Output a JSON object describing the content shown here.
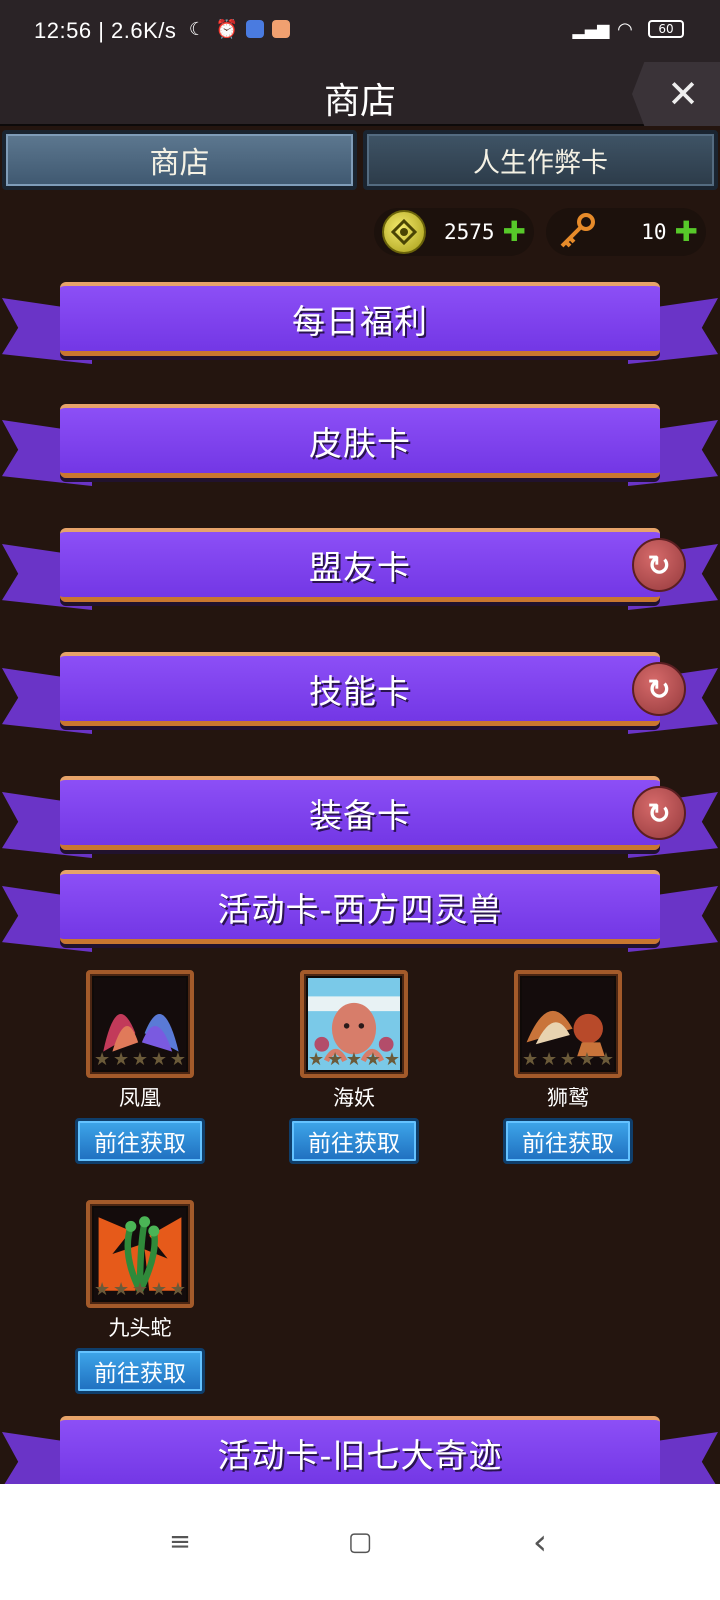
{
  "status": {
    "time": "12:56",
    "speed": "| 2.6K/s",
    "battery": "60"
  },
  "header": {
    "title": "商店",
    "close_glyph": "✕"
  },
  "tabs": [
    {
      "label": "商店",
      "active": true
    },
    {
      "label": "人生作弊卡",
      "active": false
    }
  ],
  "currencies": [
    {
      "icon": "coin-icon",
      "value": "2575"
    },
    {
      "icon": "key-icon",
      "value": "10"
    }
  ],
  "sections": [
    {
      "label": "每日福利",
      "refresh": false
    },
    {
      "label": "皮肤卡",
      "refresh": false
    },
    {
      "label": "盟友卡",
      "refresh": true
    },
    {
      "label": "技能卡",
      "refresh": true
    },
    {
      "label": "装备卡",
      "refresh": true
    },
    {
      "label": "活动卡-西方四灵兽",
      "refresh": false
    },
    {
      "label": "活动卡-旧七大奇迹",
      "refresh": false
    }
  ],
  "cards": [
    {
      "name": "凤凰",
      "button": "前往获取",
      "art_colors": [
        "#c23a5a",
        "#5a7ad6"
      ]
    },
    {
      "name": "海妖",
      "button": "前往获取",
      "art_colors": [
        "#d77d6a",
        "#7ac9e8"
      ]
    },
    {
      "name": "狮鹫",
      "button": "前往获取",
      "art_colors": [
        "#c9743a",
        "#e8d3b0"
      ]
    },
    {
      "name": "九头蛇",
      "button": "前往获取",
      "art_colors": [
        "#e65a1a",
        "#2f8a3a"
      ]
    }
  ],
  "nav": {
    "menu": "≡",
    "home": "▢",
    "back": "‹"
  }
}
